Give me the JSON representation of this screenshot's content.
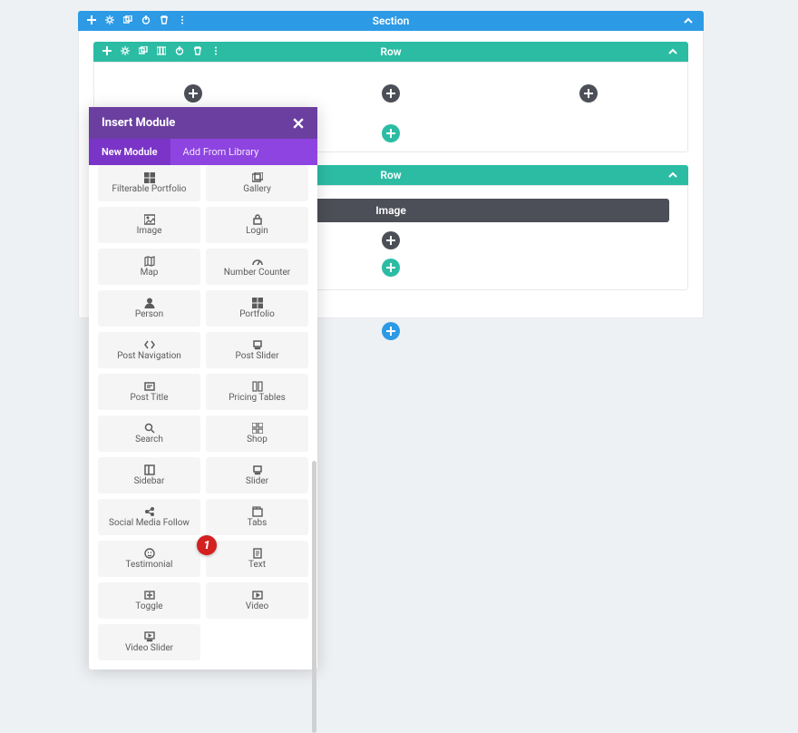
{
  "colors": {
    "section": "#2d9ae5",
    "row": "#2cbca4",
    "module": "#4c4f57",
    "modal_header": "#6b3fa0",
    "modal_tabs": "#8e44e0",
    "badge": "#d32020"
  },
  "structure": {
    "section_label": "Section",
    "row_label": "Row",
    "row2_label": "Row",
    "module_label": "Image"
  },
  "modal": {
    "title": "Insert Module",
    "tabs": {
      "new": "New Module",
      "library": "Add From Library"
    },
    "modules": [
      {
        "name": "Filterable Portfolio",
        "icon": "grid"
      },
      {
        "name": "Gallery",
        "icon": "images"
      },
      {
        "name": "Image",
        "icon": "image"
      },
      {
        "name": "Login",
        "icon": "lock"
      },
      {
        "name": "Map",
        "icon": "map"
      },
      {
        "name": "Number Counter",
        "icon": "speed"
      },
      {
        "name": "Person",
        "icon": "person"
      },
      {
        "name": "Portfolio",
        "icon": "grid"
      },
      {
        "name": "Post Navigation",
        "icon": "nav"
      },
      {
        "name": "Post Slider",
        "icon": "slider"
      },
      {
        "name": "Post Title",
        "icon": "title"
      },
      {
        "name": "Pricing Tables",
        "icon": "pricing"
      },
      {
        "name": "Search",
        "icon": "search"
      },
      {
        "name": "Shop",
        "icon": "shop"
      },
      {
        "name": "Sidebar",
        "icon": "sidebar"
      },
      {
        "name": "Slider",
        "icon": "slider"
      },
      {
        "name": "Social Media Follow",
        "icon": "social"
      },
      {
        "name": "Tabs",
        "icon": "tabs"
      },
      {
        "name": "Testimonial",
        "icon": "testimonial"
      },
      {
        "name": "Text",
        "icon": "text"
      },
      {
        "name": "Toggle",
        "icon": "toggle"
      },
      {
        "name": "Video",
        "icon": "video"
      },
      {
        "name": "Video Slider",
        "icon": "videoslider"
      }
    ],
    "badge": {
      "text": "1",
      "target": "Text"
    }
  }
}
